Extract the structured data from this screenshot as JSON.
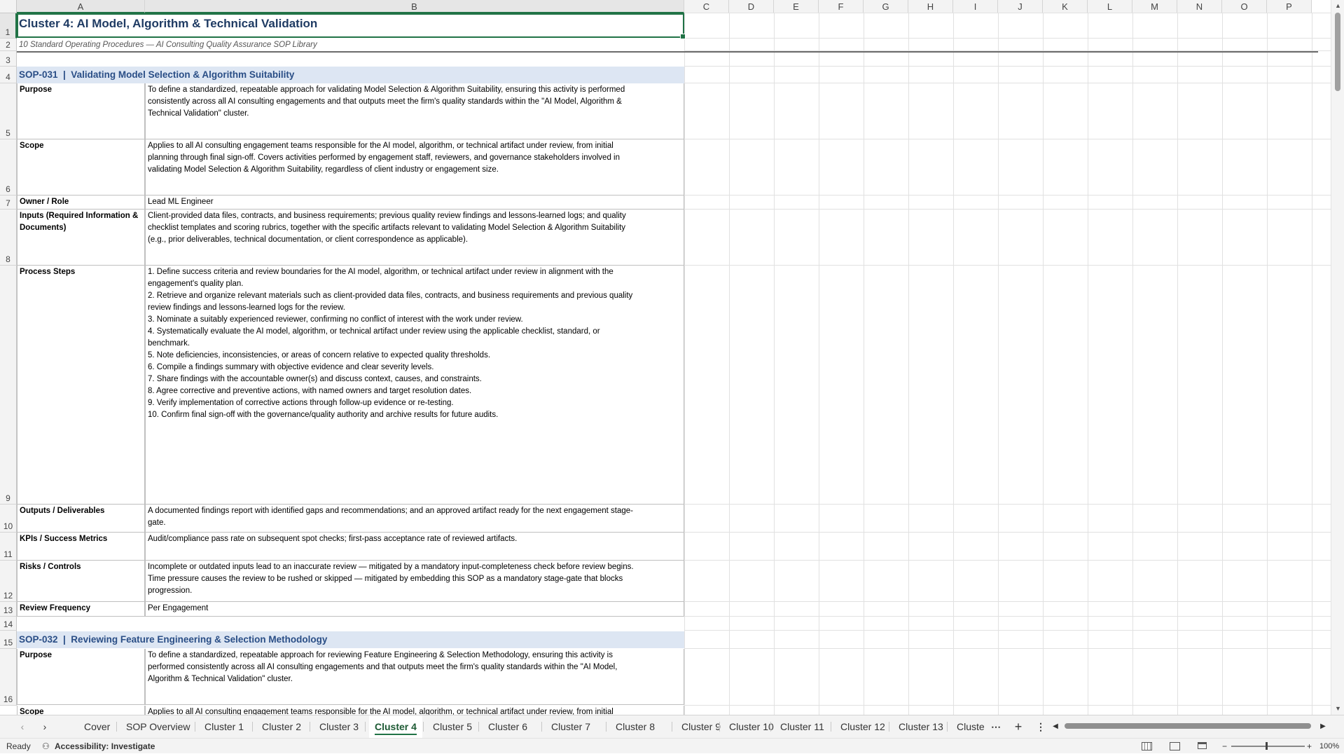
{
  "columns": [
    "A",
    "B",
    "C",
    "D",
    "E",
    "F",
    "G",
    "H",
    "I",
    "J",
    "K",
    "L",
    "M",
    "N",
    "O",
    "P"
  ],
  "rows": [
    "1",
    "2",
    "3",
    "4",
    "5",
    "6",
    "7",
    "8",
    "9",
    "10",
    "11",
    "12",
    "13",
    "14",
    "15",
    "16"
  ],
  "cells": {
    "title": "Cluster 4: AI Model, Algorithm & Technical Validation",
    "subtitle": "10 Standard Operating Procedures — AI Consulting Quality Assurance SOP Library",
    "sop031_header": "SOP-031  |  Validating Model Selection & Algorithm Suitability",
    "sop031": [
      {
        "label": "Purpose",
        "value": "To define a standardized, repeatable approach for validating Model Selection & Algorithm Suitability, ensuring this activity is performed\nconsistently across all AI consulting engagements and that outputs meet the firm's quality standards within the \"AI Model, Algorithm &\nTechnical Validation\" cluster."
      },
      {
        "label": "Scope",
        "value": "Applies to all AI consulting engagement teams responsible for the AI model, algorithm, or technical artifact under review, from initial\nplanning through final sign-off. Covers activities performed by engagement staff, reviewers, and governance stakeholders involved in\nvalidating Model Selection & Algorithm Suitability, regardless of client industry or engagement size."
      },
      {
        "label": "Owner / Role",
        "value": "Lead ML Engineer"
      },
      {
        "label": "Inputs (Required Information &\nDocuments)",
        "value": "Client-provided data files, contracts, and business requirements; previous quality review findings and lessons-learned logs; and quality\nchecklist templates and scoring rubrics, together with the specific artifacts relevant to validating Model Selection & Algorithm Suitability\n(e.g., prior deliverables, technical documentation, or client correspondence as applicable)."
      },
      {
        "label": "Process Steps",
        "value": "1. Define success criteria and review boundaries for the AI model, algorithm, or technical artifact under review in alignment with the\nengagement's quality plan.\n2. Retrieve and organize relevant materials such as client-provided data files, contracts, and business requirements and previous quality\nreview findings and lessons-learned logs for the review.\n3. Nominate a suitably experienced reviewer, confirming no conflict of interest with the work under review.\n4. Systematically evaluate the AI model, algorithm, or technical artifact under review using the applicable checklist, standard, or\nbenchmark.\n5. Note deficiencies, inconsistencies, or areas of concern relative to expected quality thresholds.\n6. Compile a findings summary with objective evidence and clear severity levels.\n7. Share findings with the accountable owner(s) and discuss context, causes, and constraints.\n8. Agree corrective and preventive actions, with named owners and target resolution dates.\n9. Verify implementation of corrective actions through follow-up evidence or re-testing.\n10. Confirm final sign-off with the governance/quality authority and archive results for future audits."
      },
      {
        "label": "Outputs / Deliverables",
        "value": "A documented findings report with identified gaps and recommendations; and an approved artifact ready for the next engagement stage-\ngate."
      },
      {
        "label": "KPIs / Success Metrics",
        "value": "Audit/compliance pass rate on subsequent spot checks; first-pass acceptance rate of reviewed artifacts."
      },
      {
        "label": "Risks / Controls",
        "value": "Incomplete or outdated inputs lead to an inaccurate review — mitigated by a mandatory input-completeness check before review begins.\nTime pressure causes the review to be rushed or skipped — mitigated by embedding this SOP as a mandatory stage-gate that blocks\nprogression."
      },
      {
        "label": "Review Frequency",
        "value": "Per Engagement"
      }
    ],
    "sop032_header": "SOP-032  |  Reviewing Feature Engineering & Selection Methodology",
    "sop032_purpose_label": "Purpose",
    "sop032_purpose": "To define a standardized, repeatable approach for reviewing Feature Engineering & Selection Methodology, ensuring this activity is\nperformed consistently across all AI consulting engagements and that outputs meet the firm's quality standards within the \"AI Model,\nAlgorithm & Technical Validation\" cluster.",
    "sop032_scope_label": "Scope",
    "sop032_scope": "Applies to all AI consulting engagement teams responsible for the AI model, algorithm, or technical artifact under review, from initial"
  },
  "sheet_tabs": [
    "Cover",
    "SOP Overview",
    "Cluster 1",
    "Cluster 2",
    "Cluster 3",
    "Cluster 4",
    "Cluster 5",
    "Cluster 6",
    "Cluster 7",
    "Cluster 8",
    "Cluster 9",
    "Cluster 10",
    "Cluster 11",
    "Cluster 12",
    "Cluster 13",
    "Cluste"
  ],
  "active_tab": "Cluster 4",
  "status": {
    "ready": "Ready",
    "accessibility": "Accessibility: Investigate",
    "zoom": "100%"
  },
  "icons": [
    "nav-prev-icon",
    "nav-next-icon",
    "more-sheets-icon",
    "add-sheet-icon",
    "sheet-options-icon",
    "scroll-left-icon",
    "scroll-right-icon",
    "accessibility-icon",
    "normal-view-icon",
    "page-layout-icon",
    "page-break-icon",
    "zoom-out-icon",
    "zoom-in-icon"
  ],
  "colors": {
    "accent": "#217346",
    "sop_header_bg": "#dde6f3",
    "sop_header_text": "#2a4e86",
    "title_text": "#1f3b63"
  }
}
